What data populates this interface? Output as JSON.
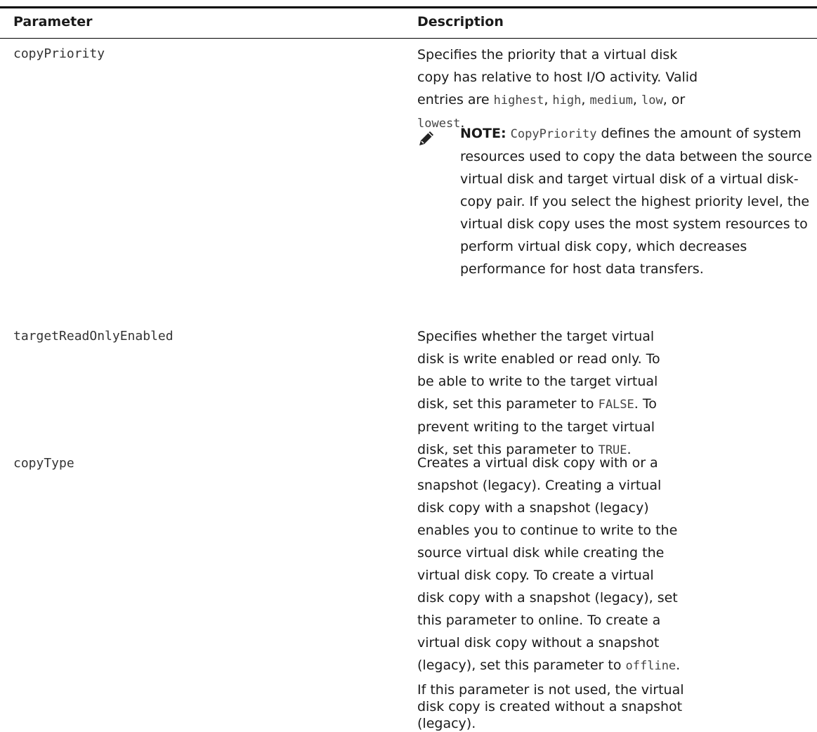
{
  "header": {
    "col1": "Parameter",
    "col2": "Description"
  },
  "rows": [
    {
      "param": "copyPriority",
      "desc_pre": "Specifies the priority that a virtual disk copy has relative to host I/O activity. Valid entries are ",
      "opt1": "highest",
      "sep1": ", ",
      "opt2": "high",
      "sep2": ", ",
      "opt3": "medium",
      "sep3": ", ",
      "opt4": "low",
      "sep4": ", or ",
      "opt5": "lowest",
      "end": ".",
      "note_label": "NOTE:",
      "note_code": "CopyPriority",
      "note_text": " defines the amount of system resources used to copy the data between the source virtual disk and target virtual disk of a virtual disk-copy pair. If you select the highest priority level, the virtual disk copy uses the most system resources to perform virtual disk copy, which decreases performance for host data transfers."
    },
    {
      "param": "targetReadOnlyEnabled",
      "desc_pre": "Specifies whether the target virtual disk is write enabled or read only. To be able to write to the target virtual disk, set this parameter to ",
      "code1": "FALSE",
      "desc_mid": ". To prevent writing to the target virtual disk, set this parameter to ",
      "code2": "TRUE",
      "end": "."
    },
    {
      "param": "copyType",
      "desc_pre": "Creates a virtual disk copy with or a snapshot (legacy). Creating a virtual disk copy with a snapshot (legacy) enables you to continue to write to the source virtual disk while creating the virtual disk copy. To create a virtual disk copy with a snapshot (legacy), set this parameter to online. To create a virtual disk copy without a snapshot (legacy), set this parameter to ",
      "code1": "offline",
      "end": ".",
      "para2": "If this parameter is not used, the virtual disk copy is created without a snapshot (legacy)."
    }
  ]
}
